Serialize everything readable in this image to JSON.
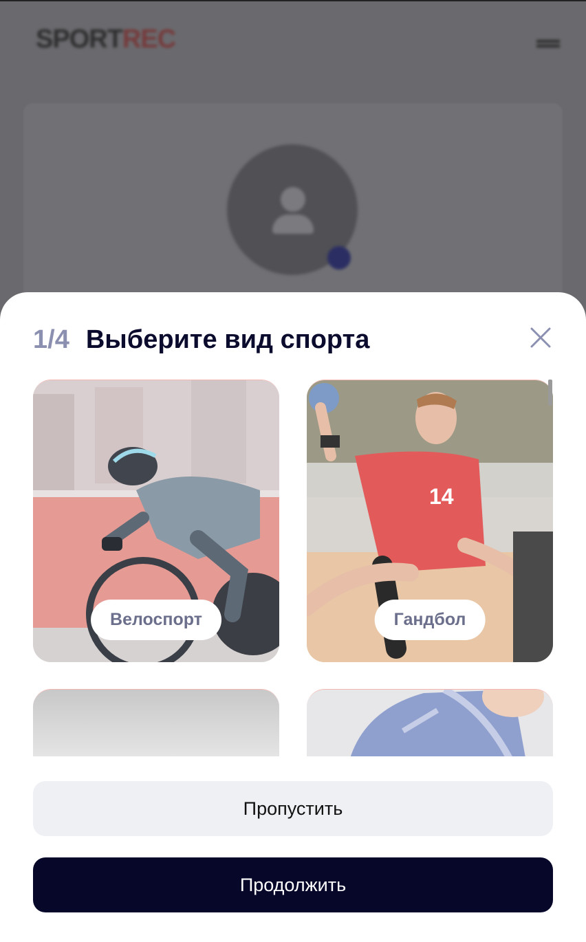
{
  "background": {
    "logo_part1": "SPORT",
    "logo_part2": "REC"
  },
  "sheet": {
    "step": "1/4",
    "title": "Выберите вид спорта",
    "close_icon": "close-icon",
    "sports": [
      {
        "label": "Велоспорт",
        "selected": false
      },
      {
        "label": "Гандбол",
        "selected": false
      },
      {
        "label": "",
        "selected": false
      },
      {
        "label": "",
        "selected": false
      }
    ],
    "skip_label": "Пропустить",
    "continue_label": "Продолжить"
  },
  "colors": {
    "primary": "#07072a",
    "title": "#0b0b2e",
    "step": "#8b8fb0",
    "secondary_button": "#eff0f4",
    "label_text": "#6b6f8c"
  }
}
